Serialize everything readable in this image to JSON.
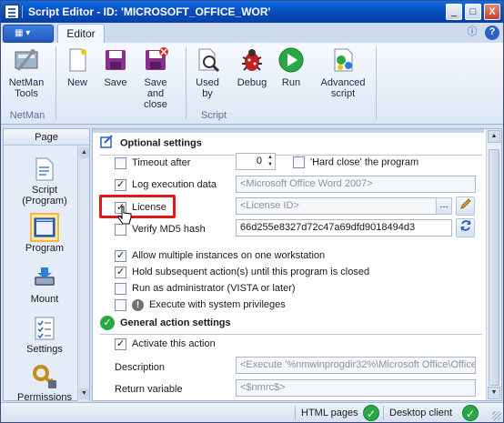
{
  "window": {
    "title": "Script Editor - ID: 'MICROSOFT_OFFICE_WOR'",
    "controls": {
      "minimize": "_",
      "maximize": "□",
      "close": "X"
    }
  },
  "ribbon": {
    "app_button": "▾",
    "tabs": [
      {
        "label": "Editor",
        "active": true
      }
    ],
    "help_icons": [
      "info-icon",
      "help-icon"
    ],
    "groups": [
      {
        "label": "NetMan",
        "buttons": [
          {
            "label": "NetMan Tools",
            "icon": "netman-tools-icon"
          }
        ]
      },
      {
        "label": "Script",
        "buttons": [
          {
            "label": "New",
            "icon": "new-doc-icon"
          },
          {
            "label": "Save",
            "icon": "save-icon"
          },
          {
            "label": "Save and close",
            "icon": "save-close-icon"
          },
          {
            "label": "Used by",
            "icon": "used-by-icon"
          },
          {
            "label": "Debug",
            "icon": "debug-bug-icon"
          },
          {
            "label": "Run",
            "icon": "run-play-icon"
          },
          {
            "label": "Advanced script",
            "icon": "advanced-script-icon"
          }
        ]
      }
    ]
  },
  "sidebar": {
    "header": "Page",
    "items": [
      {
        "label": "Script (Program)",
        "icon": "script-icon",
        "selected": false
      },
      {
        "label": "Program",
        "icon": "program-icon",
        "selected": true
      },
      {
        "label": "Mount",
        "icon": "mount-icon",
        "selected": false
      },
      {
        "label": "Settings",
        "icon": "settings-list-icon",
        "selected": false
      },
      {
        "label": "Permissions",
        "icon": "permissions-key-icon",
        "selected": false
      }
    ]
  },
  "optional_settings": {
    "title": "Optional settings",
    "timeout_after": {
      "label": "Timeout after",
      "checked": false,
      "value": "0"
    },
    "hard_close": {
      "label": "'Hard close' the program",
      "checked": false
    },
    "log_execution_data": {
      "label": "Log execution data",
      "checked": true,
      "placeholder": "<Microsoft Office Word 2007>"
    },
    "license": {
      "label": "License",
      "checked": true,
      "placeholder": "<License ID>",
      "browse": "..."
    },
    "verify_md5": {
      "label": "Verify MD5 hash",
      "checked": false,
      "value": "66d255e8327d72c47a69dfd9018494d3"
    },
    "allow_multiple": {
      "label": "Allow multiple instances on one workstation",
      "checked": true
    },
    "hold_subsequent": {
      "label": "Hold subsequent action(s) until this program is closed",
      "checked": true
    },
    "run_as_admin": {
      "label": "Run as administrator (VISTA or later)",
      "checked": false
    },
    "execute_system": {
      "label": "Execute with system privileges",
      "checked": false
    }
  },
  "general_action_settings": {
    "title": "General action settings",
    "activate": {
      "label": "Activate this action",
      "checked": true
    },
    "description": {
      "label": "Description",
      "placeholder": "<Execute '%nmwinprogdir32%\\Microsoft Office\\Office"
    },
    "return_variable": {
      "label": "Return variable",
      "placeholder": "<$nmrc$>"
    }
  },
  "status_bar": {
    "html_pages": "HTML pages",
    "desktop_client": "Desktop client"
  },
  "colors": {
    "titlebar": "#0a4fc0",
    "highlight_box": "#e01818",
    "ok_green": "#2aa845"
  }
}
